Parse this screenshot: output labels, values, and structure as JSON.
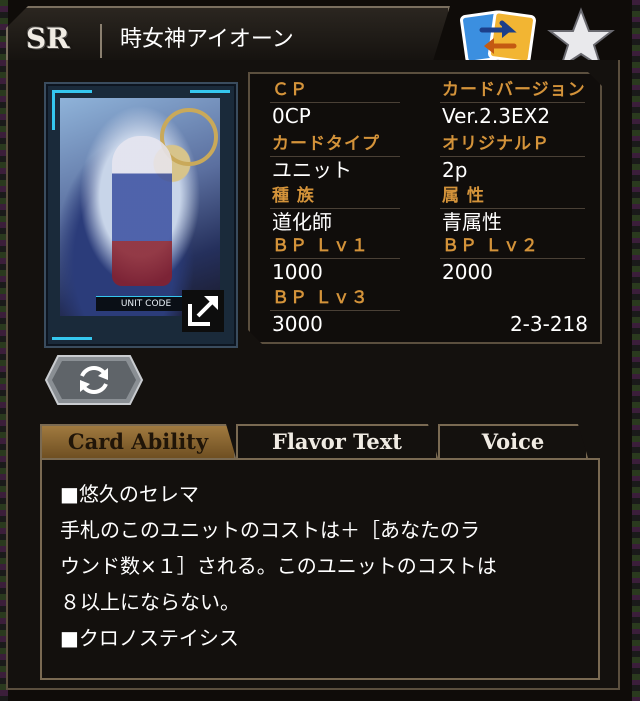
{
  "header": {
    "rarity": "SR",
    "card_name": "時女神アイオーン"
  },
  "card": {
    "unit_code_label": "UNIT CODE"
  },
  "stats": {
    "cp_label": "ＣＰ",
    "cp_value": "0CP",
    "version_label": "カードバージョン",
    "version_value": "Ver.2.3EX2",
    "type_label": "カードタイプ",
    "type_value": "ユニット",
    "original_p_label": "オリジナルＰ",
    "original_p_value": "2p",
    "race_label": "種 族",
    "race_value": "道化師",
    "attribute_label": "属 性",
    "attribute_value": "青属性",
    "bp1_label": "ＢＰ Ｌｖ１",
    "bp1_value": "1000",
    "bp2_label": "ＢＰ Ｌｖ２",
    "bp2_value": "2000",
    "bp3_label": "ＢＰ Ｌｖ３",
    "bp3_value": "3000",
    "card_number": "2-3-218"
  },
  "tabs": [
    {
      "label": "Card Ability",
      "active": true
    },
    {
      "label": "Flavor Text",
      "active": false
    },
    {
      "label": "Voice",
      "active": false
    }
  ],
  "ability": {
    "lines": [
      "■悠久のセレマ",
      "手札のこのユニットのコストは＋［あなたのラ",
      "ウンド数×１］される。このユニットのコストは",
      "８以上にならない。",
      "■クロノステイシス"
    ]
  },
  "colors": {
    "accent_gold": "#d4933a",
    "frame_border": "#7a6a52",
    "card_cyan": "#35c7ef"
  },
  "icons": {
    "swap": "swap-arrows-icon",
    "favorite": "star-icon",
    "expand": "expand-external-icon",
    "rotate": "rotate-arrows-icon"
  }
}
